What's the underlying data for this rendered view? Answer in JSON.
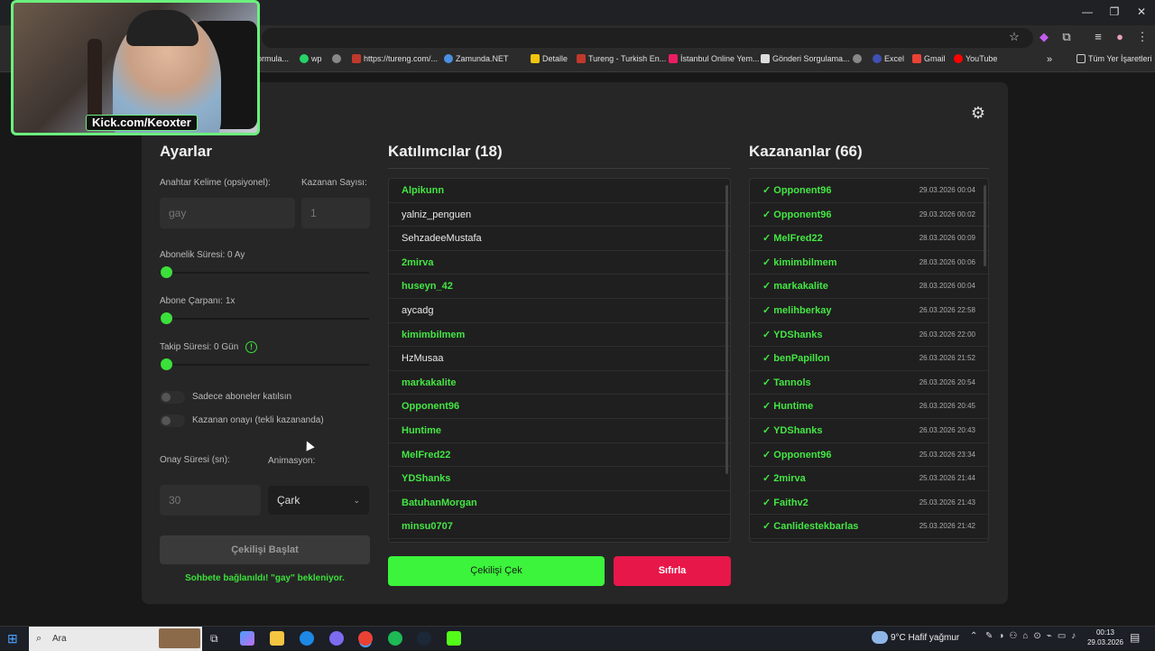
{
  "browser": {
    "window_controls": [
      "—",
      "❐",
      "✕"
    ],
    "bookmarks": [
      {
        "label": "ormula...",
        "color": "#888"
      },
      {
        "label": "wp",
        "color": "#25d366"
      },
      {
        "label": "",
        "color": "#888"
      },
      {
        "label": "https://tureng.com/...",
        "color": "#c0392b"
      },
      {
        "label": "Zamunda.NET",
        "color": "#4a90e2"
      },
      {
        "label": "Detalle",
        "color": "#f1c40f"
      },
      {
        "label": "Tureng - Turkish En...",
        "color": "#c0392b"
      },
      {
        "label": "İstanbul Online Yem...",
        "color": "#e91e63"
      },
      {
        "label": "Gönderi Sorgulama...",
        "color": "#ddd"
      },
      {
        "label": "",
        "color": "#888"
      },
      {
        "label": "Excel",
        "color": "#3f51b5"
      },
      {
        "label": "Gmail",
        "color": "#ea4335"
      },
      {
        "label": "YouTube",
        "color": "#ff0000"
      }
    ],
    "all_bookmarks": "Tüm Yer İşaretleri"
  },
  "webcam": {
    "label": "Kick.com/Keoxter"
  },
  "settings": {
    "title": "Ayarlar",
    "keyword_label": "Anahtar Kelime (opsiyonel):",
    "keyword_value": "gay",
    "winner_count_label": "Kazanan Sayısı:",
    "winner_count_value": "1",
    "sub_duration_label": "Abonelik Süresi: 0 Ay",
    "sub_multiplier_label": "Abone Çarpanı: 1x",
    "follow_duration_label": "Takip Süresi:  0  Gün",
    "only_subs_label": "Sadece aboneler katılsın",
    "winner_confirm_label": "Kazanan onayı (tekli kazananda)",
    "confirm_time_label": "Onay Süresi (sn):",
    "confirm_time_value": "30",
    "animation_label": "Animasyon:",
    "animation_value": "Çark",
    "start_button": "Çekilişi Başlat",
    "status_text": "Sohbete bağlanıldı! \"gay\" bekleniyor."
  },
  "participants": {
    "title": "Katılımcılar (18)",
    "items": [
      {
        "name": "Alpikunn",
        "sub": true
      },
      {
        "name": "yalniz_penguen",
        "sub": false
      },
      {
        "name": "SehzadeeMustafa",
        "sub": false
      },
      {
        "name": "2mirva",
        "sub": true
      },
      {
        "name": "huseyn_42",
        "sub": true
      },
      {
        "name": "aycadg",
        "sub": false
      },
      {
        "name": "kimimbilmem",
        "sub": true
      },
      {
        "name": "HzMusaa",
        "sub": false
      },
      {
        "name": "markakalite",
        "sub": true
      },
      {
        "name": "Opponent96",
        "sub": true
      },
      {
        "name": "Huntime",
        "sub": true
      },
      {
        "name": "MelFred22",
        "sub": true
      },
      {
        "name": "YDShanks",
        "sub": true
      },
      {
        "name": "BatuhanMorgan",
        "sub": true
      },
      {
        "name": "minsu0707",
        "sub": true
      }
    ],
    "draw_button": "Çekilişi Çek",
    "reset_button": "Sıfırla"
  },
  "winners": {
    "title": "Kazananlar (66)",
    "items": [
      {
        "name": "✓ Opponent96",
        "date": "29.03.2026 00:04"
      },
      {
        "name": "✓ Opponent96",
        "date": "29.03.2026 00:02"
      },
      {
        "name": "✓ MelFred22",
        "date": "28.03.2026 00:09"
      },
      {
        "name": "✓ kimimbilmem",
        "date": "28.03.2026 00:06"
      },
      {
        "name": "✓ markakalite",
        "date": "28.03.2026 00:04"
      },
      {
        "name": "✓ melihberkay",
        "date": "26.03.2026 22:58"
      },
      {
        "name": "✓ YDShanks",
        "date": "26.03.2026 22:00"
      },
      {
        "name": "✓ benPapillon",
        "date": "26.03.2026 21:52"
      },
      {
        "name": "✓ Tannols",
        "date": "26.03.2026 20:54"
      },
      {
        "name": "✓ Huntime",
        "date": "26.03.2026 20:45"
      },
      {
        "name": "✓ YDShanks",
        "date": "26.03.2026 20:43"
      },
      {
        "name": "✓ Opponent96",
        "date": "25.03.2026 23:34"
      },
      {
        "name": "✓ 2mirva",
        "date": "25.03.2026 21:44"
      },
      {
        "name": "✓ Faithv2",
        "date": "25.03.2026 21:43"
      },
      {
        "name": "✓ Canlidestekbarlas",
        "date": "25.03.2026 21:42"
      }
    ]
  },
  "taskbar": {
    "search_placeholder": "Ara",
    "weather": "9°C  Hafif yağmur",
    "time": "00:13",
    "date": "29.03.2026"
  },
  "colors": {
    "accent": "#3be03b",
    "danger": "#e8174a"
  }
}
